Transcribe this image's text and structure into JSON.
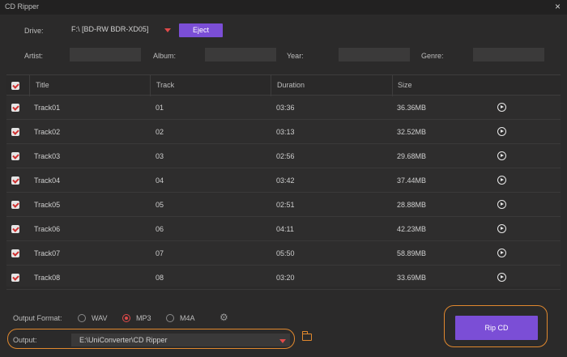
{
  "window": {
    "title": "CD Ripper",
    "close_glyph": "×"
  },
  "drive": {
    "label": "Drive:",
    "value": "F:\\ [BD-RW   BDR-XD05]",
    "eject_label": "Eject"
  },
  "meta": {
    "artist_label": "Artist:",
    "album_label": "Album:",
    "year_label": "Year:",
    "genre_label": "Genre:"
  },
  "table": {
    "headers": [
      "Title",
      "Track",
      "Duration",
      "Size"
    ],
    "rows": [
      {
        "title": "Track01",
        "track": "01",
        "duration": "03:36",
        "size": "36.36MB"
      },
      {
        "title": "Track02",
        "track": "02",
        "duration": "03:13",
        "size": "32.52MB"
      },
      {
        "title": "Track03",
        "track": "03",
        "duration": "02:56",
        "size": "29.68MB"
      },
      {
        "title": "Track04",
        "track": "04",
        "duration": "03:42",
        "size": "37.44MB"
      },
      {
        "title": "Track05",
        "track": "05",
        "duration": "02:51",
        "size": "28.88MB"
      },
      {
        "title": "Track06",
        "track": "06",
        "duration": "04:11",
        "size": "42.23MB"
      },
      {
        "title": "Track07",
        "track": "07",
        "duration": "05:50",
        "size": "58.89MB"
      },
      {
        "title": "Track08",
        "track": "08",
        "duration": "03:20",
        "size": "33.69MB"
      }
    ]
  },
  "output_format": {
    "label": "Output Format:",
    "options": [
      "WAV",
      "MP3",
      "M4A"
    ],
    "selected": "MP3"
  },
  "output": {
    "label": "Output:",
    "path": "E:\\UniConverter\\CD Ripper"
  },
  "rip_label": "Rip CD",
  "colors": {
    "accent": "#7b4ed6",
    "highlight": "#e0882e",
    "check": "#cf2f2f"
  },
  "icons": {
    "settings": "gear-icon",
    "folder": "folder-icon",
    "play": "play-icon"
  }
}
